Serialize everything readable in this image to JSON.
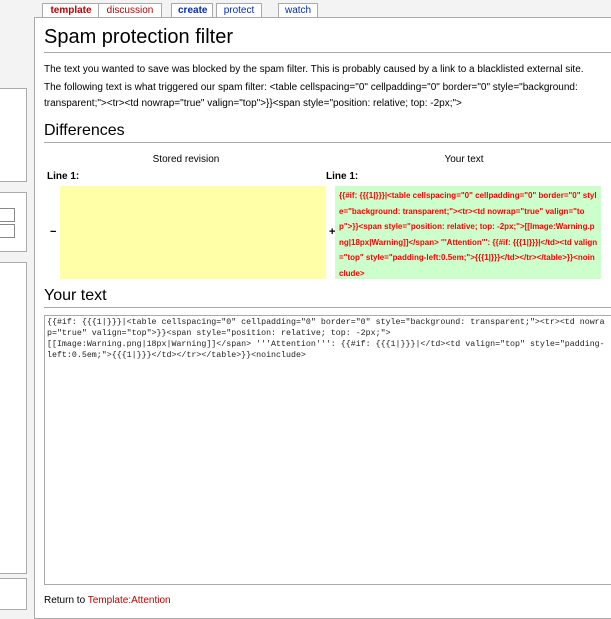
{
  "tabs": [
    {
      "label": "template"
    },
    {
      "label": "discussion"
    },
    {
      "label": "create"
    },
    {
      "label": "protect"
    },
    {
      "label": "watch"
    }
  ],
  "page": {
    "title": "Spam protection filter",
    "intro": "The text you wanted to save was blocked by the spam filter. This is probably caused by a link to a blacklisted external site.",
    "trigger": "The following text is what triggered our spam filter: <table cellspacing=\"0\" cellpadding=\"0\" border=\"0\" style=\"background: transparent;\"><tr><td nowrap=\"true\" valign=\"top\">}}<span style=\"position: relative; top: -2px;\">"
  },
  "differences": {
    "heading": "Differences",
    "stored_label": "Stored revision",
    "your_label": "Your text",
    "line_left": "Line 1:",
    "line_right": "Line 1:",
    "minus": "−",
    "plus": "+",
    "added_text": "{{#if: {{{1|}}}|<table cellspacing=\"0\" cellpadding=\"0\" border=\"0\" style=\"background: transparent;\"><tr><td nowrap=\"true\" valign=\"top\">}}<span style=\"position: relative; top: -2px;\">[[Image:Warning.png|18px|Warning]]</span> '''Attention''': {{#if: {{{1|}}}|</td><td valign=\"top\" style=\"padding-left:0.5em;\">{{{1|}}}</td></tr></table>}}<noinclude>"
  },
  "your_text": {
    "heading": "Your text",
    "value": "{{#if: {{{1|}}}|<table cellspacing=\"0\" cellpadding=\"0\" border=\"0\" style=\"background: transparent;\"><tr><td nowrap=\"true\" valign=\"top\">}}<span style=\"position: relative; top: -2px;\">\n[[Image:Warning.png|18px|Warning]]</span> '''Attention''': {{#if: {{{1|}}}|</td><td valign=\"top\" style=\"padding-left:0.5em;\">{{{1|}}}</td></tr></table>}}<noinclude>"
  },
  "footer": {
    "return_prefix": "Return to ",
    "return_link": "Template:Attention"
  }
}
